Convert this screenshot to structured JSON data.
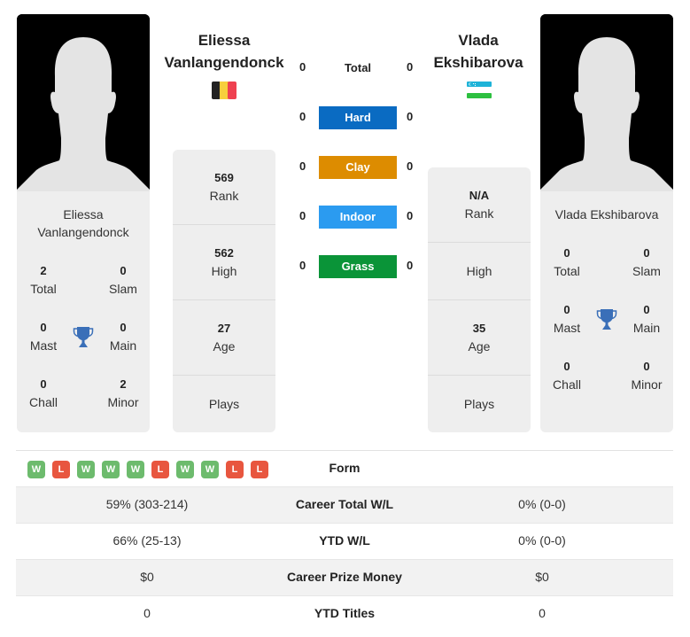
{
  "player1": {
    "name": "Eliessa Vanlangendonck",
    "name_line1": "Eliessa",
    "name_line2": "Vanlangendonck",
    "flag": "belgium-flag",
    "titles": {
      "total": {
        "value": "2",
        "label": "Total"
      },
      "slam": {
        "value": "0",
        "label": "Slam"
      },
      "mast": {
        "value": "0",
        "label": "Mast"
      },
      "main": {
        "value": "0",
        "label": "Main"
      },
      "chall": {
        "value": "0",
        "label": "Chall"
      },
      "minor": {
        "value": "2",
        "label": "Minor"
      }
    },
    "info": {
      "rank": {
        "value": "569",
        "label": "Rank"
      },
      "high": {
        "value": "562",
        "label": "High"
      },
      "age": {
        "value": "27",
        "label": "Age"
      },
      "plays": {
        "value": "",
        "label": "Plays"
      }
    }
  },
  "player2": {
    "name": "Vlada Ekshibarova",
    "name_line1": "Vlada",
    "name_line2": "Ekshibarova",
    "flag": "uzbekistan-flag",
    "titles": {
      "total": {
        "value": "0",
        "label": "Total"
      },
      "slam": {
        "value": "0",
        "label": "Slam"
      },
      "mast": {
        "value": "0",
        "label": "Mast"
      },
      "main": {
        "value": "0",
        "label": "Main"
      },
      "chall": {
        "value": "0",
        "label": "Chall"
      },
      "minor": {
        "value": "0",
        "label": "Minor"
      }
    },
    "info": {
      "rank": {
        "value": "N/A",
        "label": "Rank"
      },
      "high": {
        "value": "",
        "label": "High"
      },
      "age": {
        "value": "35",
        "label": "Age"
      },
      "plays": {
        "value": "",
        "label": "Plays"
      }
    }
  },
  "h2h": [
    {
      "label": "Total",
      "p1": "0",
      "p2": "0",
      "color": ""
    },
    {
      "label": "Hard",
      "p1": "0",
      "p2": "0",
      "color": "#0a6bc2"
    },
    {
      "label": "Clay",
      "p1": "0",
      "p2": "0",
      "color": "#dd8c00"
    },
    {
      "label": "Indoor",
      "p1": "0",
      "p2": "0",
      "color": "#2b9bf0"
    },
    {
      "label": "Grass",
      "p1": "0",
      "p2": "0",
      "color": "#0a9438"
    }
  ],
  "stats": {
    "form_label": "Form",
    "p1_form": [
      "W",
      "L",
      "W",
      "W",
      "W",
      "L",
      "W",
      "W",
      "L",
      "L"
    ],
    "rows": [
      {
        "label": "Career Total W/L",
        "p1": "59% (303-214)",
        "p2": "0% (0-0)"
      },
      {
        "label": "YTD W/L",
        "p1": "66% (25-13)",
        "p2": "0% (0-0)"
      },
      {
        "label": "Career Prize Money",
        "p1": "$0",
        "p2": "$0"
      },
      {
        "label": "YTD Titles",
        "p1": "0",
        "p2": "0"
      }
    ]
  },
  "colors": {
    "win": "#6dbb6d",
    "loss": "#e8563f",
    "trophy": "#3a6fb8"
  }
}
